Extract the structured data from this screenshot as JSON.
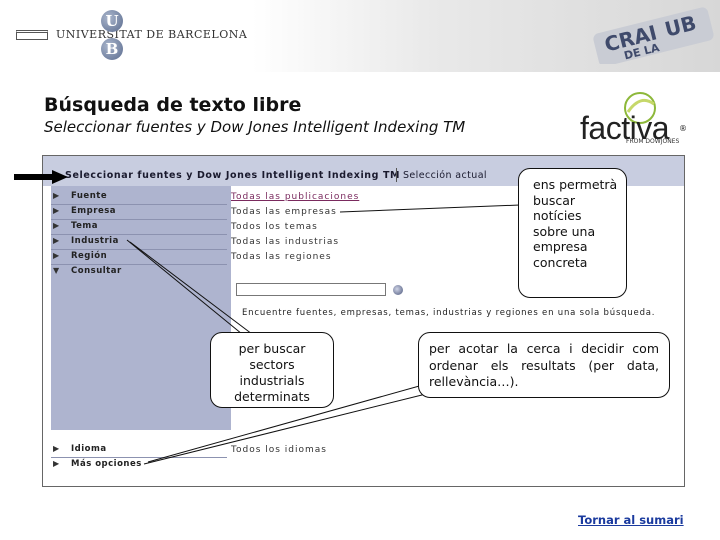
{
  "header": {
    "university_name": "UNIVERSITAT DE BARCELONA",
    "logo_letters": [
      "U",
      "B"
    ],
    "crai_logo_text": [
      "CRAI",
      "DE LA",
      "UB"
    ]
  },
  "slide": {
    "title": "Búsqueda de texto libre",
    "subtitle": "Seleccionar fuentes y Dow Jones Intelligent  Indexing TM",
    "factiva": {
      "word": "factiva",
      "reg": "®",
      "from": "FROM DOWJONES"
    }
  },
  "screenshot": {
    "header_left": "Seleccionar fuentes y Dow Jones Intelligent Indexing TM",
    "header_right": "Selección actual",
    "menu": [
      {
        "label": "Fuente",
        "value": "Todas las publicaciones",
        "arrow": "▶"
      },
      {
        "label": "Empresa",
        "value": "Todas las empresas",
        "arrow": "▶"
      },
      {
        "label": "Tema",
        "value": "Todos los temas",
        "arrow": "▶"
      },
      {
        "label": "Industria",
        "value": "Todas las industrias",
        "arrow": "▶"
      },
      {
        "label": "Región",
        "value": "Todas las regiones",
        "arrow": "▶"
      },
      {
        "label": "Consultar",
        "value": "",
        "arrow": "▼"
      }
    ],
    "search_hint": "Encuentre fuentes, empresas, temas, industrias y regiones en una sola búsqueda.",
    "menu_bottom": [
      {
        "label": "Idioma",
        "value": "Todos los idiomas",
        "arrow": "▶"
      },
      {
        "label": "Más opciones",
        "value": "",
        "arrow": "▶"
      }
    ]
  },
  "callouts": {
    "empresa": "ens permetrà buscar notícies sobre una empresa concreta",
    "sectors": "per buscar sectors industrials determinats",
    "ordenar": "per acotar la cerca i decidir com ordenar els resultats (per data, rellevància…)."
  },
  "footer": {
    "return_link": "Tornar al sumari"
  }
}
